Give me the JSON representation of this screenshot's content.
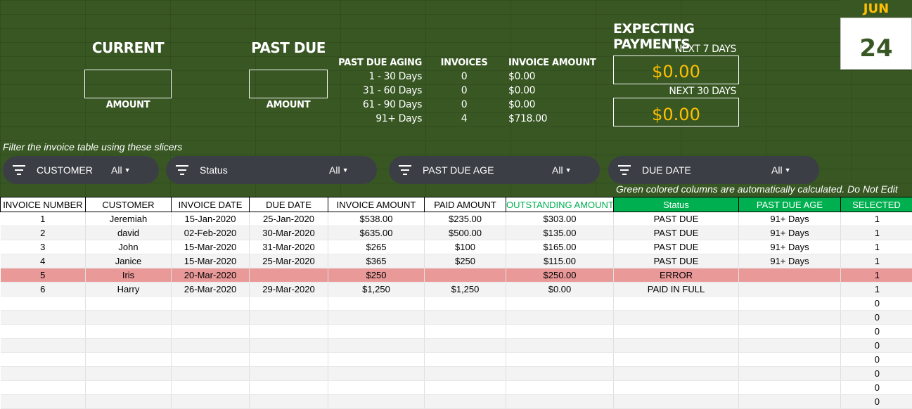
{
  "dashboard": {
    "current_title": "CURRENT",
    "current_amount_label": "AMOUNT",
    "past_due_title": "PAST DUE",
    "past_due_amount_label": "AMOUNT",
    "aging_headers": {
      "age": "PAST DUE AGING",
      "invoices": "INVOICES",
      "amount": "INVOICE AMOUNT"
    },
    "aging_rows": [
      {
        "age": "1 - 30 Days",
        "invoices": "0",
        "amount": "$0.00"
      },
      {
        "age": "31 - 60 Days",
        "invoices": "0",
        "amount": "$0.00"
      },
      {
        "age": "61 - 90 Days",
        "invoices": "0",
        "amount": "$0.00"
      },
      {
        "age": "91+ Days",
        "invoices": "4",
        "amount": "$718.00"
      }
    ],
    "expecting_title": "EXPECTING PAYMENTS",
    "next7_label": "NEXT 7 DAYS",
    "next7_value": "$0.00",
    "next30_label": "NEXT 30 DAYS",
    "next30_value": "$0.00",
    "calendar": {
      "month": "JUN",
      "day": "24"
    },
    "filter_note": "Filter the invoice table using these slicers",
    "green_note": "Green colored columns are automatically calculated. Do Not Edit"
  },
  "slicers": [
    {
      "label": "CUSTOMER",
      "value": "All"
    },
    {
      "label": "Status",
      "value": "All"
    },
    {
      "label": "PAST DUE AGE",
      "value": "All"
    },
    {
      "label": "DUE DATE",
      "value": "All"
    }
  ],
  "colors": {
    "dashboard_bg": "#385723",
    "accent_gold": "#ffc000",
    "calc_green": "#00b050",
    "error_row": "#ea9999",
    "slicer_bg": "#3b3f45"
  },
  "table": {
    "headers": [
      "INVOICE NUMBER",
      "CUSTOMER",
      "INVOICE DATE",
      "DUE DATE",
      "INVOICE AMOUNT",
      "PAID AMOUNT",
      "OUTSTANDING AMOUNT",
      "Status",
      "PAST DUE AGE",
      "SELECTED"
    ],
    "rows": [
      [
        "1",
        "Jeremiah",
        "15-Jan-2020",
        "25-Jan-2020",
        "$538.00",
        "$235.00",
        "$303.00",
        "PAST DUE",
        "91+ Days",
        "1"
      ],
      [
        "2",
        "david",
        "02-Feb-2020",
        "30-Mar-2020",
        "$635.00",
        "$500.00",
        "$135.00",
        "PAST DUE",
        "91+ Days",
        "1"
      ],
      [
        "3",
        "John",
        "15-Mar-2020",
        "31-Mar-2020",
        "$265",
        "$100",
        "$165.00",
        "PAST DUE",
        "91+ Days",
        "1"
      ],
      [
        "4",
        "Janice",
        "15-Mar-2020",
        "25-Mar-2020",
        "$365",
        "$250",
        "$115.00",
        "PAST DUE",
        "91+ Days",
        "1"
      ],
      [
        "5",
        "Iris",
        "20-Mar-2020",
        "",
        "$250",
        "",
        "$250.00",
        "ERROR",
        "",
        "1"
      ],
      [
        "6",
        "Harry",
        "26-Mar-2020",
        "29-Mar-2020",
        "$1,250",
        "$1,250",
        "$0.00",
        "PAID IN FULL",
        "",
        "1"
      ],
      [
        "",
        "",
        "",
        "",
        "",
        "",
        "",
        "",
        "",
        "0"
      ],
      [
        "",
        "",
        "",
        "",
        "",
        "",
        "",
        "",
        "",
        "0"
      ],
      [
        "",
        "",
        "",
        "",
        "",
        "",
        "",
        "",
        "",
        "0"
      ],
      [
        "",
        "",
        "",
        "",
        "",
        "",
        "",
        "",
        "",
        "0"
      ],
      [
        "",
        "",
        "",
        "",
        "",
        "",
        "",
        "",
        "",
        "0"
      ],
      [
        "",
        "",
        "",
        "",
        "",
        "",
        "",
        "",
        "",
        "0"
      ],
      [
        "",
        "",
        "",
        "",
        "",
        "",
        "",
        "",
        "",
        "0"
      ],
      [
        "",
        "",
        "",
        "",
        "",
        "",
        "",
        "",
        "",
        "0"
      ]
    ]
  }
}
